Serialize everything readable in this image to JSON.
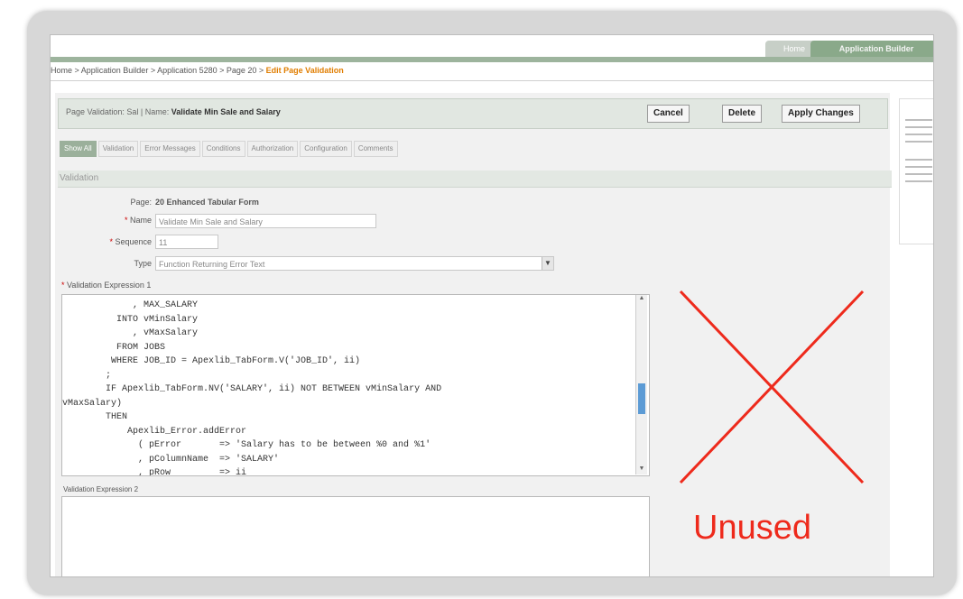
{
  "tabs": {
    "home": "Home",
    "active": "Application Builder"
  },
  "breadcrumb": {
    "path": "Home > Application Builder > Application 5280 > Page 20 > ",
    "current": "Edit Page Validation"
  },
  "titlebar": {
    "prefix": "Page Validation: Sal | Name:",
    "name": "Validate Min Sale and Salary"
  },
  "buttons": {
    "cancel": "Cancel",
    "delete": "Delete",
    "apply": "Apply Changes"
  },
  "subtabs": [
    "Show All",
    "Validation",
    "Error Messages",
    "Conditions",
    "Authorization",
    "Configuration",
    "Comments"
  ],
  "section": {
    "title": "Validation"
  },
  "fields": {
    "page_label": "Page:",
    "page_value": "20 Enhanced Tabular Form",
    "name_label": "Name",
    "name_value": "Validate Min Sale and Salary",
    "sequence_label": "Sequence",
    "sequence_value": "11",
    "type_label": "Type",
    "type_value": "Function Returning Error Text",
    "expr1_label": "Validation Expression 1",
    "expr2_label": "Validation Expression 2"
  },
  "code": "             , MAX_SALARY\n          INTO vMinSalary\n             , vMaxSalary\n          FROM JOBS\n         WHERE JOB_ID = Apexlib_TabForm.V('JOB_ID', ii)\n        ;\n        IF Apexlib_TabForm.NV('SALARY', ii) NOT BETWEEN vMinSalary AND\nvMaxSalary)\n        THEN\n            Apexlib_Error.addError\n              ( pError       => 'Salary has to be between %0 and %1'\n              , pColumnName  => 'SALARY'\n              , pRow         => ii",
  "annotation": {
    "text": "Unused",
    "color": "#ee2a1c"
  }
}
